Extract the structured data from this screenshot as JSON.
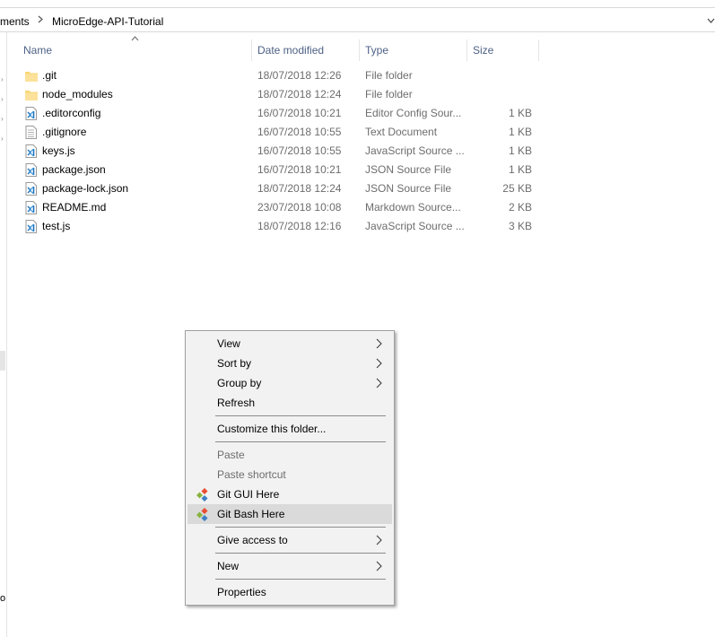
{
  "address": {
    "parent_crumb": "ments",
    "current_crumb": "MicroEdge-API-Tutorial"
  },
  "columns": {
    "name": "Name",
    "date": "Date modified",
    "type": "Type",
    "size": "Size"
  },
  "files": [
    {
      "name": ".git",
      "date": "18/07/2018 12:26",
      "type": "File folder",
      "size": "",
      "icon": "folder-icon"
    },
    {
      "name": "node_modules",
      "date": "18/07/2018 12:24",
      "type": "File folder",
      "size": "",
      "icon": "folder-icon"
    },
    {
      "name": ".editorconfig",
      "date": "16/07/2018 10:21",
      "type": "Editor Config Sour...",
      "size": "1 KB",
      "icon": "vscode-file-icon"
    },
    {
      "name": ".gitignore",
      "date": "16/07/2018 10:55",
      "type": "Text Document",
      "size": "1 KB",
      "icon": "text-file-icon"
    },
    {
      "name": "keys.js",
      "date": "16/07/2018 10:55",
      "type": "JavaScript Source ...",
      "size": "1 KB",
      "icon": "vscode-file-icon"
    },
    {
      "name": "package.json",
      "date": "16/07/2018 10:21",
      "type": "JSON Source File",
      "size": "1 KB",
      "icon": "vscode-file-icon"
    },
    {
      "name": "package-lock.json",
      "date": "18/07/2018 12:24",
      "type": "JSON Source File",
      "size": "25 KB",
      "icon": "vscode-file-icon"
    },
    {
      "name": "README.md",
      "date": "23/07/2018 10:08",
      "type": "Markdown Source...",
      "size": "2 KB",
      "icon": "vscode-file-icon"
    },
    {
      "name": "test.js",
      "date": "18/07/2018 12:16",
      "type": "JavaScript Source ...",
      "size": "3 KB",
      "icon": "vscode-file-icon"
    }
  ],
  "context_menu": {
    "view": "View",
    "sort_by": "Sort by",
    "group_by": "Group by",
    "refresh": "Refresh",
    "customize": "Customize this folder...",
    "paste": "Paste",
    "paste_shortcut": "Paste shortcut",
    "git_gui": "Git GUI Here",
    "git_bash": "Git Bash Here",
    "give_access": "Give access to",
    "new": "New",
    "properties": "Properties"
  },
  "nav_pane": {
    "partial_label": "o"
  }
}
